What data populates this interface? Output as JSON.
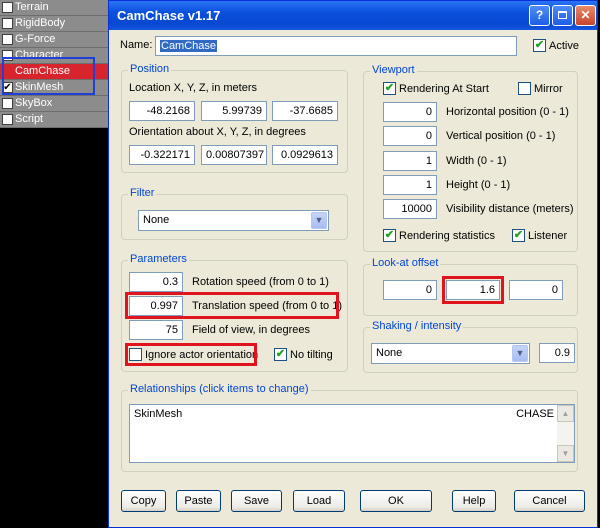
{
  "background_list": {
    "items": [
      {
        "label": "Terrain",
        "checked": false
      },
      {
        "label": "RigidBody",
        "checked": false
      },
      {
        "label": "G-Force",
        "checked": false
      },
      {
        "label": "Character",
        "checked": false
      },
      {
        "label": "CamChase",
        "checked": null
      },
      {
        "label": "SkinMesh",
        "checked": true
      },
      {
        "label": "SkyBox",
        "checked": false
      },
      {
        "label": "Script",
        "checked": false
      }
    ]
  },
  "window": {
    "title": "CamChase v1.17",
    "help_icon": "?",
    "close_icon": "✕"
  },
  "name": {
    "label": "Name:",
    "value": "CamChase"
  },
  "active": {
    "label": "Active",
    "checked": true
  },
  "position": {
    "title": "Position",
    "location_label": "Location X, Y, Z,  in meters",
    "location": [
      "-48.2168",
      "5.99739",
      "-37.6685"
    ],
    "orientation_label": "Orientation about X, Y, Z, in degrees",
    "orientation": [
      "-0.322171",
      "0.00807397",
      "0.0929613"
    ]
  },
  "filter": {
    "title": "Filter",
    "value": "None"
  },
  "parameters": {
    "title": "Parameters",
    "rotation_value": "0.3",
    "rotation_label": "Rotation speed (from 0 to 1)",
    "translation_value": "0.997",
    "translation_label": "Translation speed (from 0 to 1)",
    "fov_value": "75",
    "fov_label": "Field of view, in degrees",
    "ignore_label": "Ignore actor orientation",
    "ignore_checked": false,
    "notilt_label": "No tilting",
    "notilt_checked": true
  },
  "viewport": {
    "title": "Viewport",
    "rendering_start_label": "Rendering At Start",
    "rendering_start_checked": true,
    "mirror_label": "Mirror",
    "mirror_checked": false,
    "h_pos_value": "0",
    "h_pos_label": "Horizontal position  (0 - 1)",
    "v_pos_value": "0",
    "v_pos_label": "Vertical position  (0 - 1)",
    "width_value": "1",
    "width_label": "Width  (0 - 1)",
    "height_value": "1",
    "height_label": "Height  (0 - 1)",
    "visibility_value": "10000",
    "visibility_label": "Visibility distance (meters)",
    "stats_label": "Rendering statistics",
    "stats_checked": true,
    "listener_label": "Listener",
    "listener_checked": true
  },
  "lookat": {
    "title": "Look-at offset",
    "values": [
      "0",
      "1.6",
      "0"
    ]
  },
  "shaking": {
    "title": "Shaking / intensity",
    "value": "None",
    "intensity": "0.9"
  },
  "relationships": {
    "title": "Relationships (click items to change)",
    "rows": [
      {
        "name": "SkinMesh",
        "type": "CHASE"
      }
    ]
  },
  "buttons": {
    "copy": "Copy",
    "paste": "Paste",
    "save": "Save",
    "load": "Load",
    "ok": "OK",
    "help": "Help",
    "cancel": "Cancel"
  },
  "colors": {
    "highlight_red": "#e0141e",
    "highlight_blue": "#1f3fd6",
    "title_blue": "#0046d5"
  }
}
